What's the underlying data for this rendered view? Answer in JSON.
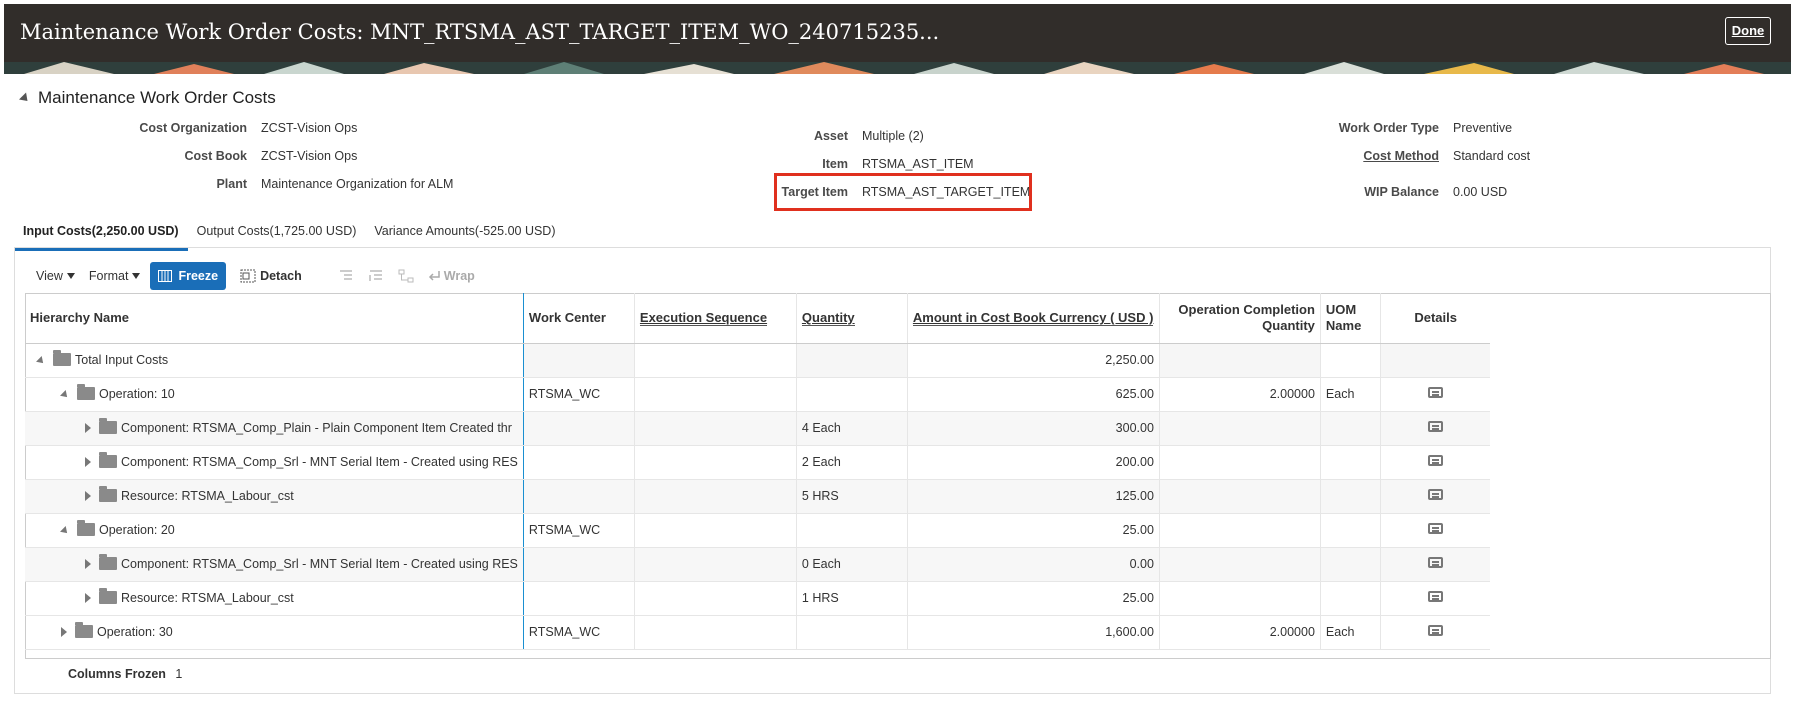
{
  "header": {
    "title": "Maintenance Work Order Costs: MNT_RTSMA_AST_TARGET_ITEM_WO_240715235...",
    "done_label": "Done"
  },
  "section": {
    "title": "Maintenance Work Order Costs"
  },
  "fields": {
    "cost_org_label": "Cost Organization",
    "cost_org_value": "ZCST-Vision Ops",
    "cost_book_label": "Cost Book",
    "cost_book_value": "ZCST-Vision Ops",
    "plant_label": "Plant",
    "plant_value": "Maintenance Organization for ALM",
    "asset_label": "Asset",
    "asset_value": "Multiple (2)",
    "item_label": "Item",
    "item_value": "RTSMA_AST_ITEM",
    "target_item_label": "Target Item",
    "target_item_value": "RTSMA_AST_TARGET_ITEM",
    "wo_type_label": "Work Order Type",
    "wo_type_value": "Preventive",
    "cost_method_label": "Cost Method",
    "cost_method_value": "Standard cost",
    "wip_label": "WIP Balance",
    "wip_value": "0.00 USD"
  },
  "tabs": [
    {
      "label": "Input Costs(2,250.00 USD)"
    },
    {
      "label": "Output Costs(1,725.00 USD)"
    },
    {
      "label": "Variance Amounts(-525.00 USD)"
    }
  ],
  "toolbar": {
    "view": "View",
    "format": "Format",
    "freeze": "Freeze",
    "detach": "Detach",
    "wrap": "Wrap"
  },
  "columns": {
    "hierarchy": "Hierarchy Name",
    "work_center": "Work Center",
    "exec_seq": "Execution Sequence",
    "quantity": "Quantity",
    "amount": "Amount in Cost Book Currency ( USD )",
    "op_qty": "Operation Completion Quantity",
    "uom": "UOM Name",
    "details": "Details"
  },
  "rows": [
    {
      "name": "Total Input Costs",
      "work_center": "",
      "quantity": "",
      "amount": "2,250.00",
      "op_qty": "",
      "uom": ""
    },
    {
      "name": "Operation: 10",
      "work_center": "RTSMA_WC",
      "quantity": "",
      "amount": "625.00",
      "op_qty": "2.00000",
      "uom": "Each"
    },
    {
      "name": "Component: RTSMA_Comp_Plain - Plain Component Item Created thr",
      "work_center": "",
      "quantity": "4 Each",
      "amount": "300.00",
      "op_qty": "",
      "uom": ""
    },
    {
      "name": "Component: RTSMA_Comp_Srl - MNT Serial Item - Created using RES",
      "work_center": "",
      "quantity": "2 Each",
      "amount": "200.00",
      "op_qty": "",
      "uom": ""
    },
    {
      "name": "Resource: RTSMA_Labour_cst",
      "work_center": "",
      "quantity": "5 HRS",
      "amount": "125.00",
      "op_qty": "",
      "uom": ""
    },
    {
      "name": "Operation: 20",
      "work_center": "RTSMA_WC",
      "quantity": "",
      "amount": "25.00",
      "op_qty": "",
      "uom": ""
    },
    {
      "name": "Component: RTSMA_Comp_Srl - MNT Serial Item - Created using RES",
      "work_center": "",
      "quantity": "0 Each",
      "amount": "0.00",
      "op_qty": "",
      "uom": ""
    },
    {
      "name": "Resource: RTSMA_Labour_cst",
      "work_center": "",
      "quantity": "1 HRS",
      "amount": "25.00",
      "op_qty": "",
      "uom": ""
    },
    {
      "name": "Operation: 30",
      "work_center": "RTSMA_WC",
      "quantity": "",
      "amount": "1,600.00",
      "op_qty": "2.00000",
      "uom": "Each"
    }
  ],
  "footer": {
    "label": "Columns Frozen",
    "value": "1"
  }
}
